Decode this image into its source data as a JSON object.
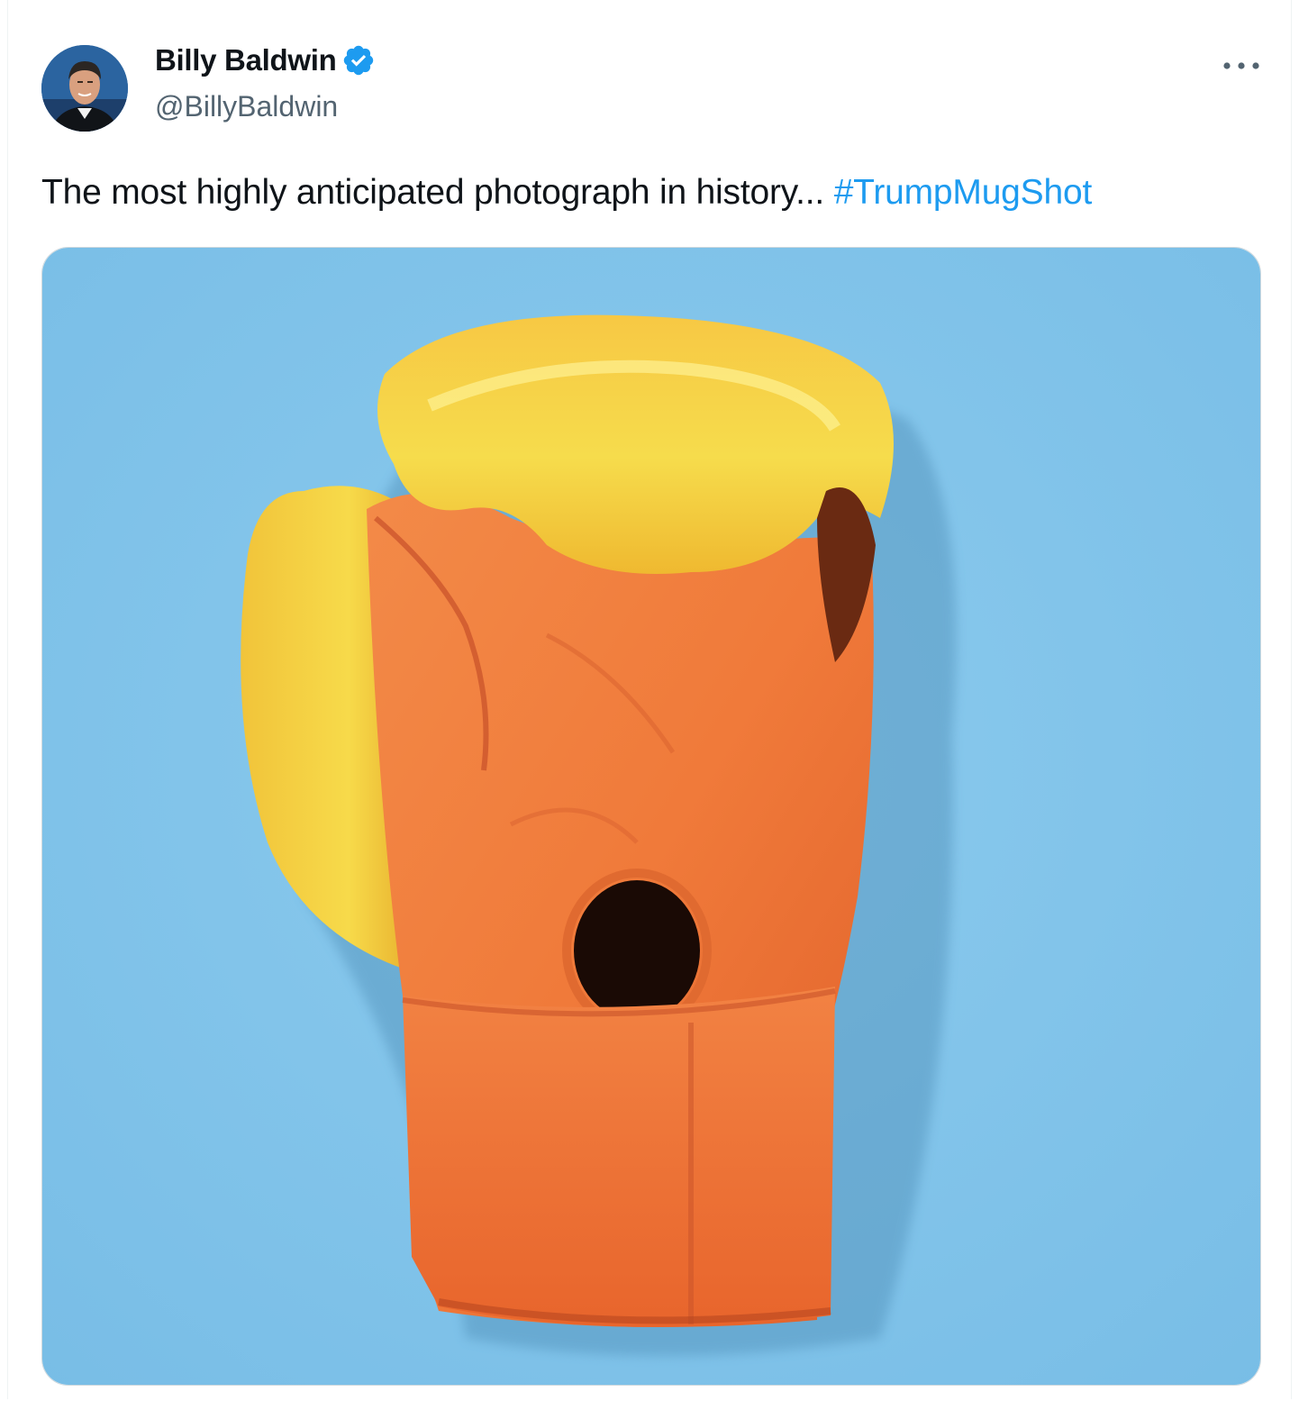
{
  "tweet": {
    "author": {
      "display_name": "Billy Baldwin",
      "handle": "@BillyBaldwin",
      "verified": true,
      "verified_badge_color": "#1d9bf0"
    },
    "text": "The most highly anticipated photograph in history... ",
    "hashtag": "#TrumpMugShot",
    "hashtag_color": "#1d9bf0",
    "more_icon": "more-horizontal-icon",
    "media": {
      "kind": "photo",
      "subject": "orange-and-yellow-boxing-glove",
      "background_color": "#85c6ea"
    }
  }
}
